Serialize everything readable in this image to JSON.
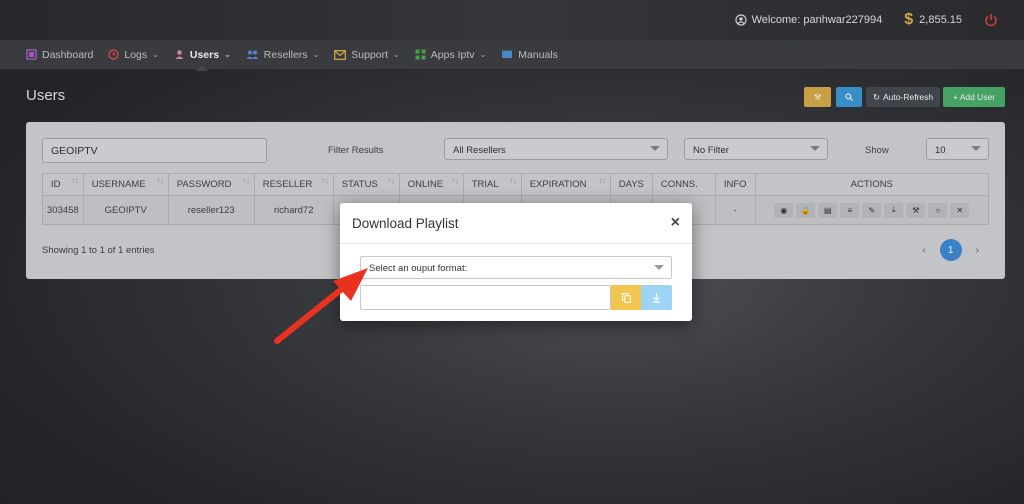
{
  "topbar": {
    "welcome": "Welcome: panhwar227994",
    "balance": "2,855.15",
    "icons": [
      "user-circle-icon",
      "dollar-icon",
      "power-icon"
    ]
  },
  "nav": {
    "items": [
      {
        "label": "Dashboard",
        "icon": "dashboard-icon",
        "caret": false
      },
      {
        "label": "Logs",
        "icon": "clock-icon",
        "caret": true
      },
      {
        "label": "Users",
        "icon": "user-icon",
        "caret": true,
        "active": true
      },
      {
        "label": "Resellers",
        "icon": "users-icon",
        "caret": true
      },
      {
        "label": "Support",
        "icon": "envelope-icon",
        "caret": true
      },
      {
        "label": "Apps Iptv",
        "icon": "grid-icon",
        "caret": true
      },
      {
        "label": "Manuals",
        "icon": "book-icon",
        "caret": false
      }
    ]
  },
  "page": {
    "title": "Users",
    "buttons": {
      "auto_refresh": "Auto-Refresh",
      "add_user": "+ Add User"
    }
  },
  "filters": {
    "search_value": "GEOIPTV",
    "filter_label": "Filter Results",
    "resellers_selected": "All Resellers",
    "status_selected": "No Filter",
    "show_label": "Show",
    "show_selected": "10"
  },
  "table": {
    "columns": [
      "ID",
      "USERNAME",
      "PASSWORD",
      "RESELLER",
      "STATUS",
      "ONLINE",
      "TRIAL",
      "EXPIRATION",
      "DAYS",
      "CONNS.",
      "INFO",
      "ACTIONS"
    ],
    "rows": [
      {
        "id": "303458",
        "username": "GEOIPTV",
        "password": "reseller123",
        "reseller": "richard72",
        "info": "-"
      }
    ],
    "showing": "Showing 1 to 1 of 1 entries",
    "page": "1"
  },
  "modal": {
    "title": "Download Playlist",
    "close": "×",
    "format_placeholder": "Select an ouput format:"
  },
  "colors": {
    "accent_blue": "#3f8ed8",
    "add_green": "#4caf6e",
    "tool_yellow": "#d9ad4a",
    "copy_yellow": "#f2c450",
    "download_blue": "#9dd3f4",
    "annotation_red": "#e8321f"
  }
}
